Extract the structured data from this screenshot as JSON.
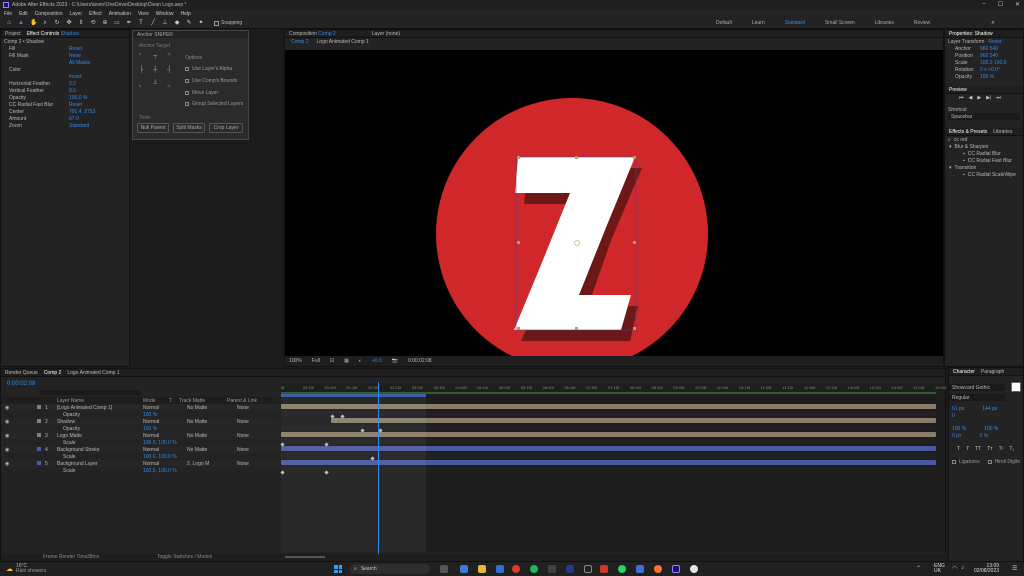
{
  "title_bar": {
    "title": "Adobe After Effects 2023 - C:\\Users\\kevin\\OneDrive\\Desktop\\Clean Logo.aep *"
  },
  "menu": [
    "File",
    "Edit",
    "Composition",
    "Layer",
    "Effect",
    "Animation",
    "View",
    "Window",
    "Help"
  ],
  "toolbar": {
    "snapping_label": "Snapping",
    "workspaces": [
      "Default",
      "Learn",
      "Standard",
      "Small Screen",
      "Libraries",
      "Review"
    ],
    "active_workspace": "Standard"
  },
  "left_panel": {
    "tab_project": "Project",
    "tab_effects": "Effect Controls",
    "effects_layer": "Shadow",
    "comp_label": "Comp 2 • Shadow",
    "rows": [
      {
        "name": "Fill",
        "value": "Reset"
      },
      {
        "name": "Fill Mask",
        "value": "None"
      },
      {
        "name": "",
        "value": "All Masks"
      },
      {
        "name": "Color",
        "value": ""
      },
      {
        "name": "",
        "value": "Invert"
      },
      {
        "name": "Horizontal Feather",
        "value": "0.0"
      },
      {
        "name": "Vertical Feather",
        "value": "0.0"
      },
      {
        "name": "Opacity",
        "value": "100.0 %"
      },
      {
        "name": "CC Radial Fast Blur",
        "value": "Reset"
      },
      {
        "name": "Center",
        "value": "791.4, 2753"
      },
      {
        "name": "Amount",
        "value": "67.0"
      },
      {
        "name": "Zoom",
        "value": "Standard"
      }
    ]
  },
  "snipper": {
    "title": "Anchor SNIPER",
    "anchor_target": "Anchor Target",
    "options_label": "Options",
    "options": [
      "Use Layer's Alpha",
      "Use Comp's Bounds",
      "Move Layer",
      "Group Selected Layers"
    ],
    "tools_label": "Tools",
    "buttons": [
      "Null Parent",
      "Split Masks",
      "Crop Layer"
    ]
  },
  "composition": {
    "tab_label": "Composition",
    "comp_name": "Comp 2",
    "layer_tab": "Layer (none)",
    "breadcrumbs": [
      "Comp 2",
      "Logo Animated Comp 1"
    ],
    "zoom": "100%",
    "resolution": "Full",
    "exposure": "+0.0",
    "timecode": "0:00:02:08",
    "logo_letter": "Z",
    "circle_color": "#d0282a"
  },
  "right_panels": {
    "properties_title": "Properties: Shadow",
    "layer_transform": "Layer Transform",
    "reset": "Reset",
    "props": [
      {
        "name": "Anchor",
        "value": "960  540"
      },
      {
        "name": "Position",
        "value": "960  540"
      },
      {
        "name": "Scale",
        "value": "100.0  100.0"
      },
      {
        "name": "Rotation",
        "value": "0 x +0.0°"
      },
      {
        "name": "Opacity",
        "value": "100 %"
      }
    ],
    "preview_title": "Preview",
    "shortcut_label": "Shortcut",
    "shortcut_value": "Spacebar",
    "effects_presets": "Effects & Presets",
    "libraries": "Libraries",
    "search_value": "cc red",
    "tree": [
      {
        "label": "Blur & Sharpen",
        "indent": 0
      },
      {
        "label": "CC Radial Blur",
        "indent": 1
      },
      {
        "label": "CC Radial Fast Blur",
        "indent": 1
      },
      {
        "label": "Transition",
        "indent": 0
      },
      {
        "label": "CC Radial ScaleWipe",
        "indent": 1
      }
    ]
  },
  "character": {
    "tab_character": "Character",
    "tab_paragraph": "Paragraph",
    "font": "Showcard Gothic",
    "style": "Regular",
    "size": "61 px",
    "leading": "144 px",
    "tracking": "0",
    "scale_v": "100 %",
    "scale_h": "100 %",
    "baseline": "0 px",
    "tsume": "0 %",
    "ligatures": "Ligatures",
    "hindi_digits": "Hindi Digits"
  },
  "timeline": {
    "tab_render": "Render Queue",
    "tab_comp": "Comp 2",
    "tab_logo": "Logo Animated Comp 1",
    "timecode": "0:00:02:08",
    "columns": [
      "Layer Name",
      "Mode",
      "T",
      "Track Matte",
      "Parent & Link"
    ],
    "layers": [
      {
        "num": "1",
        "name": "[Logo Animated Comp 1]",
        "mode": "Normal",
        "matte": "No Matte",
        "parent": "None",
        "sub": false,
        "color": "#8a7d6a"
      },
      {
        "num": "",
        "name": "Opacity",
        "mode": "",
        "matte": "",
        "parent": "",
        "sub": true,
        "value": "100 %"
      },
      {
        "num": "2",
        "name": "Shadow",
        "mode": "Normal",
        "matte": "No Matte",
        "parent": "None",
        "sub": false,
        "color": "#8a7d6a"
      },
      {
        "num": "",
        "name": "Opacity",
        "mode": "",
        "matte": "",
        "parent": "",
        "sub": true,
        "value": "100 %"
      },
      {
        "num": "3",
        "name": "Logo Matte",
        "mode": "Normal",
        "matte": "No Matte",
        "parent": "None",
        "sub": false,
        "color": "#8a7d6a"
      },
      {
        "num": "",
        "name": "Scale",
        "mode": "",
        "matte": "",
        "parent": "",
        "sub": true,
        "value": "100.0, 100.0 %"
      },
      {
        "num": "4",
        "name": "Background Stroke",
        "mode": "Normal",
        "matte": "No Matte",
        "parent": "None",
        "sub": false,
        "color": "#4a5aa0"
      },
      {
        "num": "",
        "name": "Scale",
        "mode": "",
        "matte": "",
        "parent": "",
        "sub": true,
        "value": "100.0, 100.0 %"
      },
      {
        "num": "5",
        "name": "Background Layer",
        "mode": "Normal",
        "matte": "2. Logo M",
        "parent": "None",
        "sub": false,
        "color": "#4a5aa0"
      },
      {
        "num": "",
        "name": "Scale",
        "mode": "",
        "matte": "",
        "parent": "",
        "sub": true,
        "value": "100.0, 100.0 %"
      }
    ],
    "ruler_ticks": [
      "0f",
      "00:15f",
      "01:00f",
      "01:15f",
      "02:00f",
      "02:15f",
      "03:00f",
      "03:15f",
      "04:00f",
      "04:15f",
      "05:00f",
      "05:15f",
      "06:00f",
      "06:15f",
      "07:00f",
      "07:15f",
      "08:00f",
      "08:15f",
      "09:00f",
      "09:15f",
      "10:00f",
      "10:15f",
      "11:00f",
      "11:15f",
      "12:00f",
      "12:15f",
      "13:00f",
      "13:15f",
      "14:00f",
      "14:15f",
      "15:00f"
    ],
    "frame_render_time": "Frame Render Time",
    "frame_render_value": "38ms",
    "toggle_label": "Toggle Switches / Modes"
  },
  "taskbar": {
    "weather_temp": "16°C",
    "weather_desc": "Rain showers",
    "search": "Search",
    "lang": "ENG",
    "region": "UK",
    "time": "13:09",
    "date": "02/08/2023"
  }
}
